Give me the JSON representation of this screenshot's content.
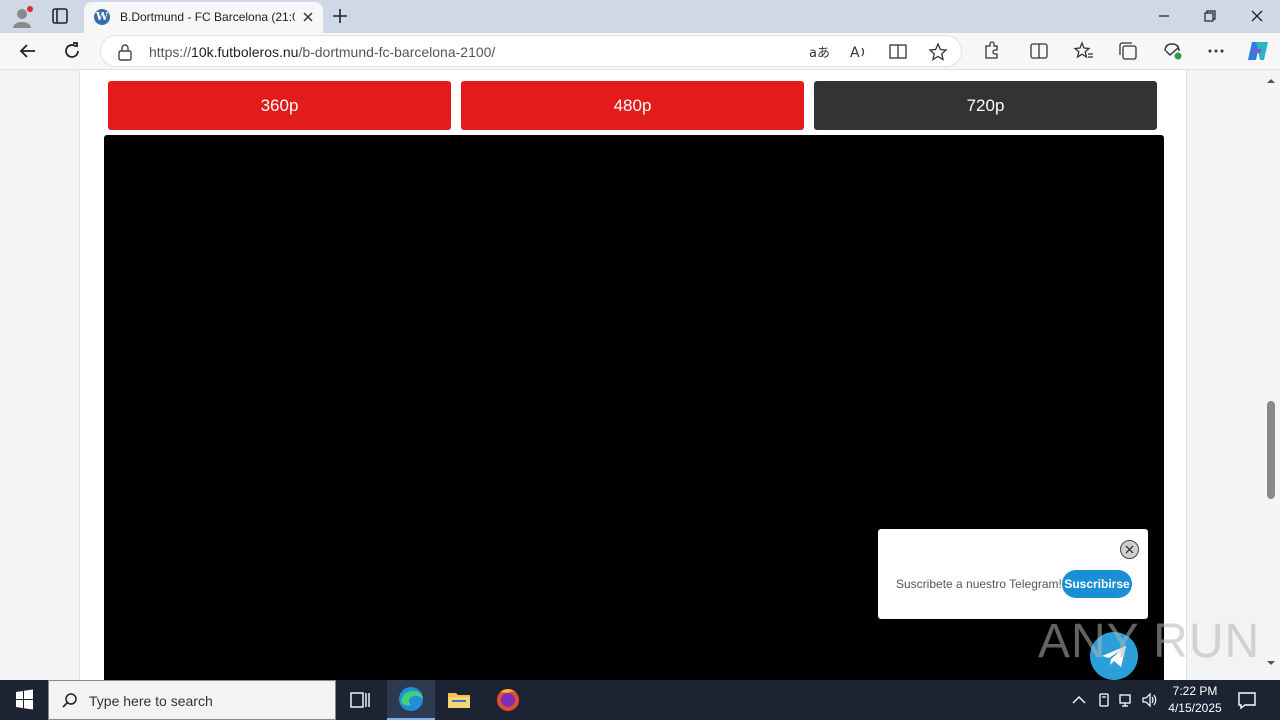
{
  "browser": {
    "tab": {
      "title": "B.Dortmund - FC Barcelona (21:0"
    },
    "address": {
      "scheme": "https://",
      "host": "10k.futboleros.nu",
      "path": "/b-dortmund-fc-barcelona-2100/"
    }
  },
  "page": {
    "quality_buttons": [
      {
        "label": "360p",
        "color": "#e31b1b"
      },
      {
        "label": "480p",
        "color": "#e31b1b"
      },
      {
        "label": "720p",
        "color": "#333333"
      }
    ]
  },
  "telegram_popup": {
    "text": "Suscribete a nuestro Telegram!",
    "button_label": "Suscribirse"
  },
  "watermark": {
    "text": "ANY RUN"
  },
  "taskbar": {
    "search_placeholder": "Type here to search",
    "time": "7:22 PM",
    "date": "4/15/2025"
  },
  "colors": {
    "accent_red": "#e31b1b",
    "dark_button": "#333333",
    "telegram_blue": "#1b8fd4"
  }
}
